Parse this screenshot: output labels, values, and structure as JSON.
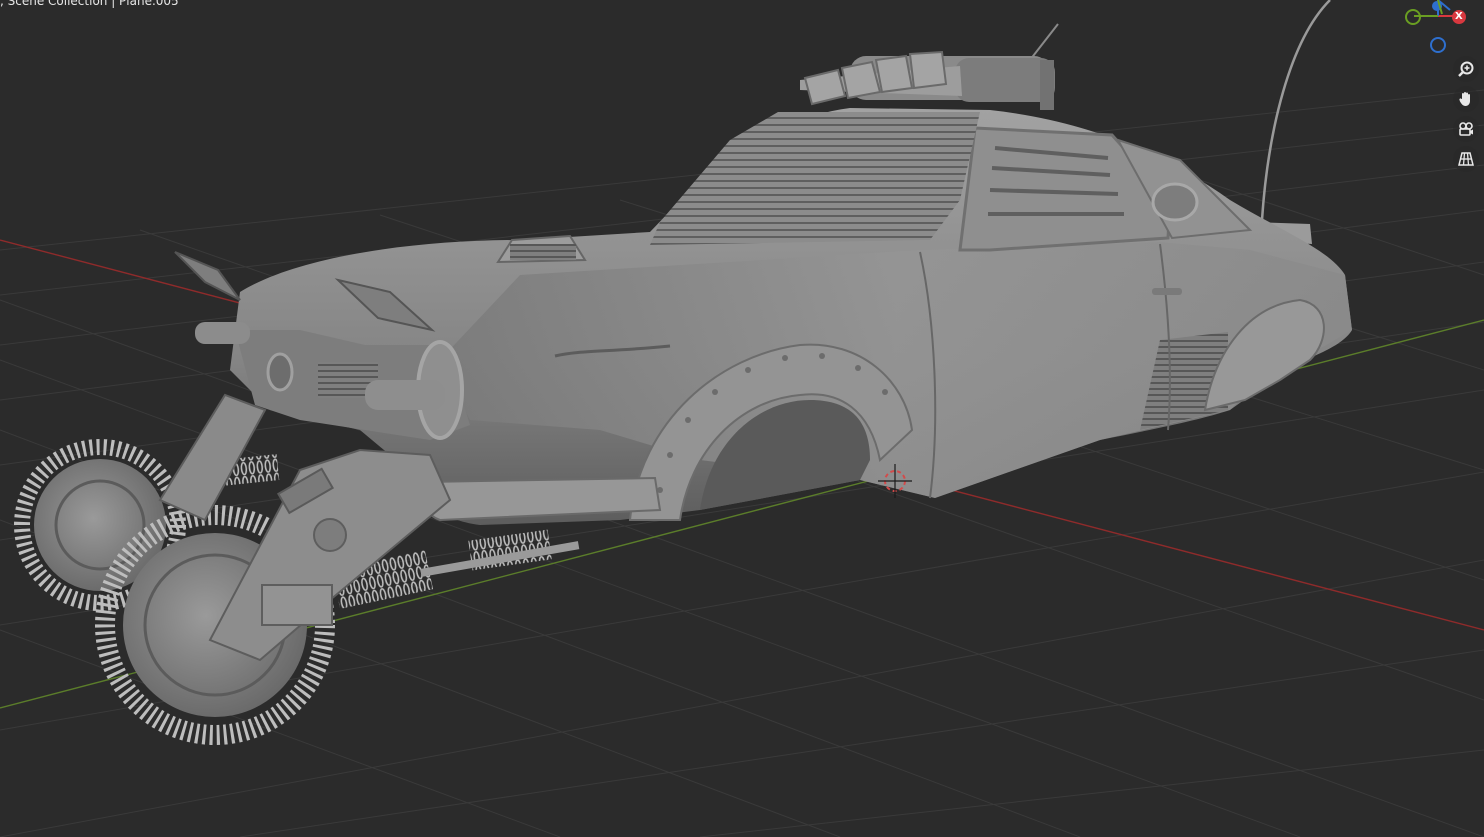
{
  "viewport": {
    "header_text": ", Scene Collection | Plane.005"
  },
  "gizmo": {
    "x_label": "X",
    "x_color": "#d8383f",
    "y_color": "#6a9e22",
    "z_color": "#2e6fce"
  },
  "nav_tools": [
    {
      "name": "zoom-icon"
    },
    {
      "name": "hand-pan-icon"
    },
    {
      "name": "camera-icon"
    },
    {
      "name": "grid-ortho-icon"
    }
  ],
  "colors": {
    "viewport_bg": "#2b2b2b",
    "grid_line": "#3a3a3a",
    "x_axis": "#8e2b2b",
    "y_axis": "#5b7d2a",
    "model_base": "#8a8a8a"
  }
}
